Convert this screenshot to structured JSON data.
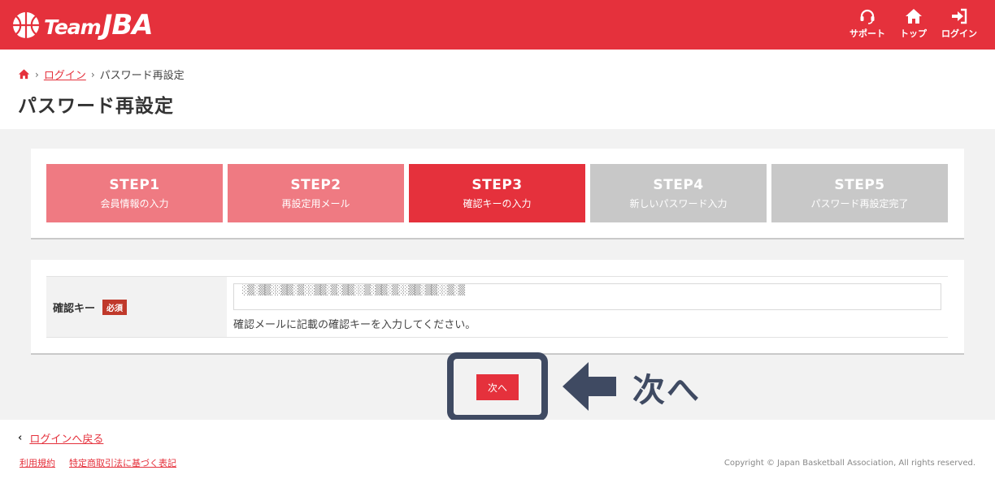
{
  "header": {
    "logo_team": "Team",
    "logo_jba": "JBA",
    "nav": [
      {
        "label": "サポート",
        "icon": "headset-icon"
      },
      {
        "label": "トップ",
        "icon": "home-icon"
      },
      {
        "label": "ログイン",
        "icon": "login-icon"
      }
    ],
    "brand_color": "#e5313c"
  },
  "breadcrumb": {
    "home_icon": "home-icon",
    "login": "ログイン",
    "current": "パスワード再設定"
  },
  "page_title": "パスワード再設定",
  "steps": [
    {
      "title": "STEP1",
      "sub": "会員情報の入力",
      "state": "done"
    },
    {
      "title": "STEP2",
      "sub": "再設定用メール",
      "state": "done"
    },
    {
      "title": "STEP3",
      "sub": "確認キーの入力",
      "state": "active"
    },
    {
      "title": "STEP4",
      "sub": "新しいパスワード入力",
      "state": "todo"
    },
    {
      "title": "STEP5",
      "sub": "パスワード再設定完了",
      "state": "todo"
    }
  ],
  "form": {
    "label": "確認キー",
    "required": "必須",
    "value": "░▒░▒▒░░▒▒░▒░░▒▒░▒░▒▒░░▒░▒▒░▒░░▒▒░▒▒░░▒░▒",
    "help": "確認メールに記載の確認キーを入力してください。"
  },
  "next_button": "次へ",
  "annotation": "次へ",
  "footer": {
    "back": "ログインへ戻る",
    "links": [
      "利用規約",
      "特定商取引法に基づく表記"
    ],
    "copyright": "Copyright © Japan Basketball Association, All rights reserved."
  }
}
